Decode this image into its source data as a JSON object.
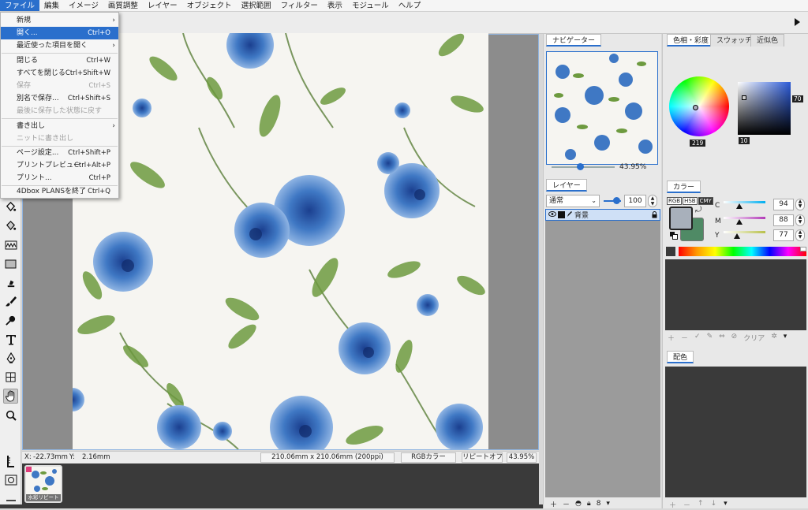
{
  "menubar": {
    "items": [
      "ファイル",
      "編集",
      "イメージ",
      "画質調整",
      "レイヤー",
      "オブジェクト",
      "選択範囲",
      "フィルター",
      "表示",
      "モジュール",
      "ヘルプ"
    ]
  },
  "file_menu": {
    "items": [
      {
        "label": "新規",
        "shortcut": "",
        "submenu": true,
        "disabled": false
      },
      {
        "label": "開く...",
        "shortcut": "Ctrl+O",
        "submenu": false,
        "disabled": false
      },
      {
        "label": "最近使った項目を開く",
        "shortcut": "",
        "submenu": true,
        "disabled": false
      },
      {
        "label": "閉じる",
        "shortcut": "Ctrl+W",
        "submenu": false,
        "disabled": false
      },
      {
        "label": "すべてを閉じる",
        "shortcut": "Ctrl+Shift+W",
        "submenu": false,
        "disabled": false
      },
      {
        "label": "保存",
        "shortcut": "Ctrl+S",
        "submenu": false,
        "disabled": true
      },
      {
        "label": "別名で保存...",
        "shortcut": "Ctrl+Shift+S",
        "submenu": false,
        "disabled": false
      },
      {
        "label": "最後に保存した状態に戻す",
        "shortcut": "",
        "submenu": false,
        "disabled": true
      },
      {
        "label": "書き出し",
        "shortcut": "",
        "submenu": true,
        "disabled": false
      },
      {
        "label": "ニットに書き出し",
        "shortcut": "",
        "submenu": false,
        "disabled": true
      },
      {
        "label": "ページ設定...",
        "shortcut": "Ctrl+Shift+P",
        "submenu": false,
        "disabled": false
      },
      {
        "label": "プリントプレビュー",
        "shortcut": "Ctrl+Alt+P",
        "submenu": false,
        "disabled": false
      },
      {
        "label": "プリント...",
        "shortcut": "Ctrl+P",
        "submenu": false,
        "disabled": false
      },
      {
        "label": "4Dbox PLANSを終了",
        "shortcut": "Ctrl+Q",
        "submenu": false,
        "disabled": false
      }
    ]
  },
  "status": {
    "x_label": "X:",
    "x_value": "-22.73mm",
    "y_label": "Y:",
    "y_value": "2.16mm",
    "doc_size": "210.06mm x 210.06mm (200ppi)",
    "color_mode": "RGBカラー",
    "repeat": "リピートオフ",
    "zoom": "43.95%"
  },
  "doc_tab": {
    "label": "水彩リピート"
  },
  "navigator": {
    "title": "ナビゲーター",
    "zoom": "43.95%"
  },
  "layers": {
    "title": "レイヤー",
    "blend_mode": "通常",
    "opacity": "100",
    "layer_name": "背景"
  },
  "color_panel": {
    "tabs": [
      "色相・彩度",
      "スウォッチ",
      "近似色"
    ],
    "hue_value": "219",
    "sat_value": "10",
    "val_value": "70",
    "color_tab": "カラー",
    "modes": [
      "RGB",
      "HSB",
      "CMY"
    ],
    "c_label": "C",
    "c_value": "94",
    "m_label": "M",
    "m_value": "88",
    "y_label": "Y",
    "y_value": "77",
    "fg_color": "#a8b0bb",
    "bg_color": "#4f8a65",
    "clear_label": "クリア"
  },
  "haishoku": {
    "title": "配色"
  }
}
